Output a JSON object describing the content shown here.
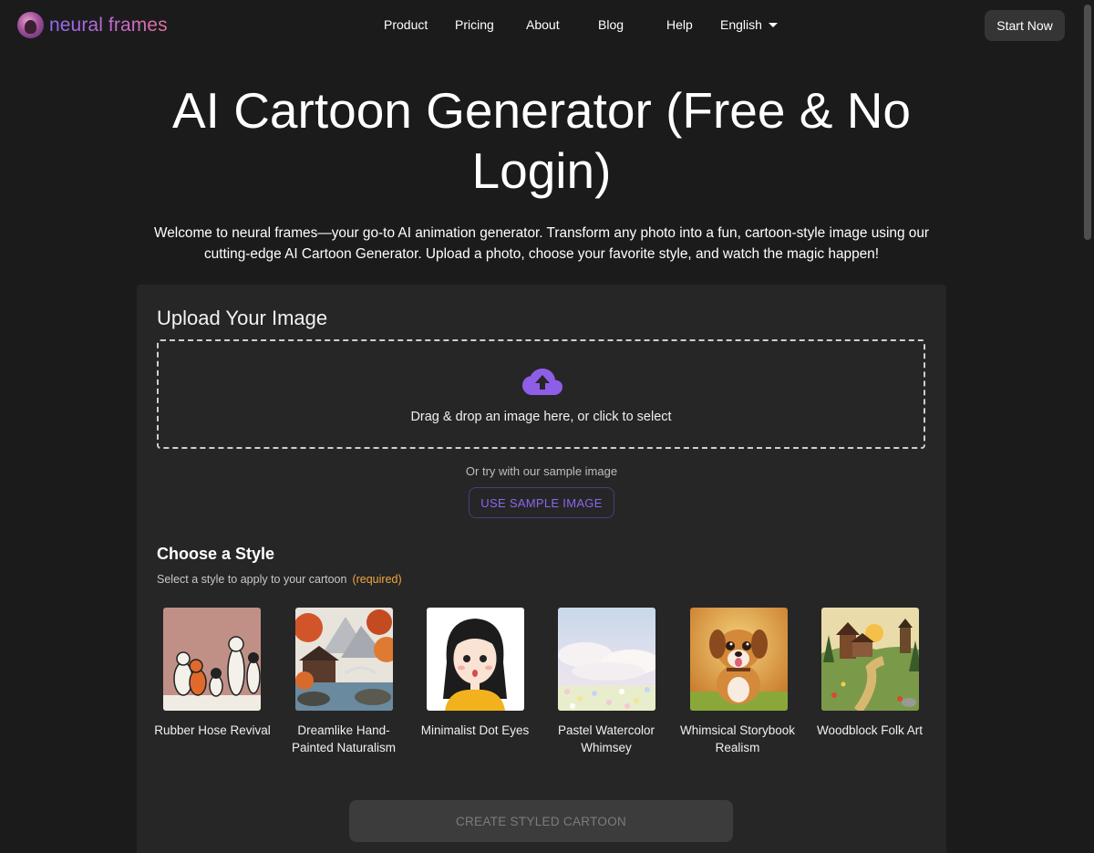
{
  "header": {
    "logo_text": "neural frames",
    "nav": [
      "Product",
      "Pricing",
      "About",
      "Blog",
      "Help"
    ],
    "language": "English",
    "start_label": "Start Now"
  },
  "hero": {
    "title": "AI Cartoon Generator (Free & No Login)",
    "description": "Welcome to neural frames—your go-to AI animation generator. Transform any photo into a fun, cartoon-style image using our cutting-edge AI Cartoon Generator. Upload a photo, choose your favorite style, and watch the magic happen!"
  },
  "upload": {
    "title": "Upload Your Image",
    "dropzone_text": "Drag & drop an image here, or click to select",
    "sample_prompt": "Or try with our sample image",
    "sample_button": "USE SAMPLE IMAGE"
  },
  "styles": {
    "title": "Choose a Style",
    "subtitle": "Select a style to apply to your cartoon",
    "required": "(required)",
    "items": [
      {
        "label": "Rubber Hose Revival"
      },
      {
        "label": "Dreamlike Hand-Painted Naturalism"
      },
      {
        "label": "Minimalist Dot Eyes"
      },
      {
        "label": "Pastel Watercolor Whimsey"
      },
      {
        "label": "Whimsical Storybook Realism"
      },
      {
        "label": "Woodblock Folk Art"
      }
    ]
  },
  "create_button": "CREATE STYLED CARTOON",
  "colors": {
    "background": "#1b1b1c",
    "card": "#262627",
    "accent": "#8b66f0",
    "required": "#f0a640"
  }
}
